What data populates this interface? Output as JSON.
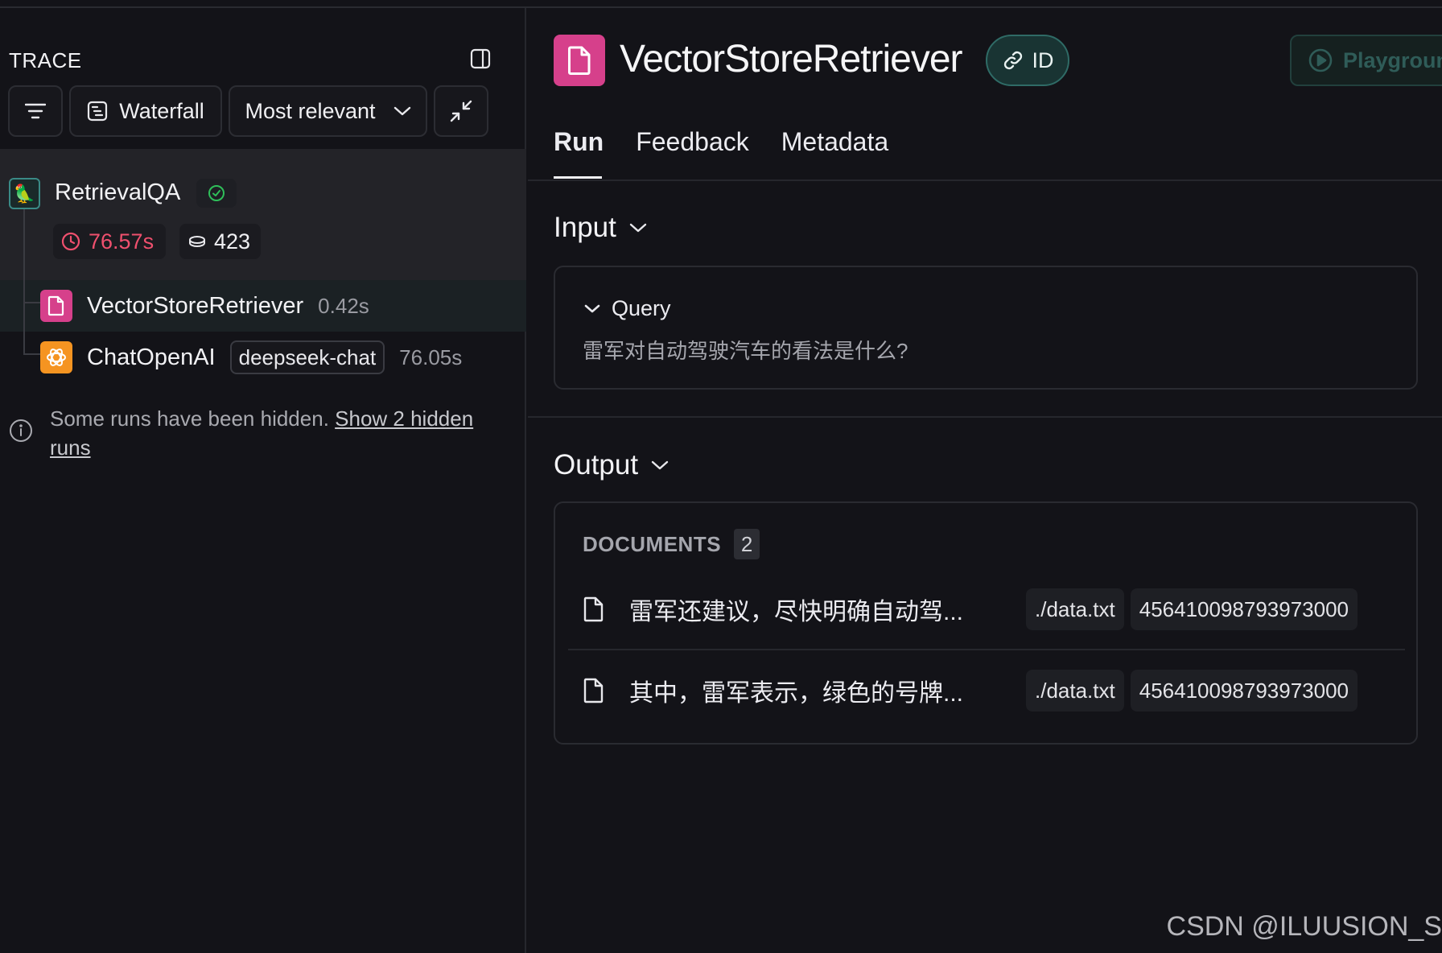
{
  "trace": {
    "title": "TRACE",
    "toolbar": {
      "waterfall_label": "Waterfall",
      "sort_label": "Most relevant"
    },
    "root": {
      "name": "RetrievalQA",
      "latency": "76.57s",
      "tokens": "423",
      "icon": "parrot-icon"
    },
    "children": [
      {
        "name": "VectorStoreRetriever",
        "time": "0.42s",
        "icon": "document-icon",
        "color": "#d6408b"
      },
      {
        "name": "ChatOpenAI",
        "model": "deepseek-chat",
        "time": "76.05s",
        "icon": "openai-icon",
        "color": "#f59421"
      }
    ],
    "hidden_note": {
      "text": "Some runs have been hidden.",
      "link": "Show 2 hidden runs"
    }
  },
  "run": {
    "title": "VectorStoreRetriever",
    "id_label": "ID",
    "playground_label": "Playground",
    "tabs": [
      "Run",
      "Feedback",
      "Metadata"
    ],
    "input": {
      "label": "Input",
      "query_label": "Query",
      "query_value": "雷军对自动驾驶汽车的看法是什么?"
    },
    "output": {
      "label": "Output",
      "documents_label": "DOCUMENTS",
      "documents_count": "2",
      "documents": [
        {
          "text": "雷军还建议，尽快明确自动驾...",
          "source": "./data.txt",
          "id": "456410098793973000"
        },
        {
          "text": "其中，雷军表示，绿色的号牌...",
          "source": "./data.txt",
          "id": "456410098793973000"
        }
      ]
    }
  },
  "watermark": "CSDN @ILUUSION_S",
  "colors": {
    "accent_teal": "#2f6b66",
    "pink": "#d6408b",
    "orange": "#f59421",
    "latency_red": "#f0506e",
    "success_green": "#2fbf5a"
  }
}
